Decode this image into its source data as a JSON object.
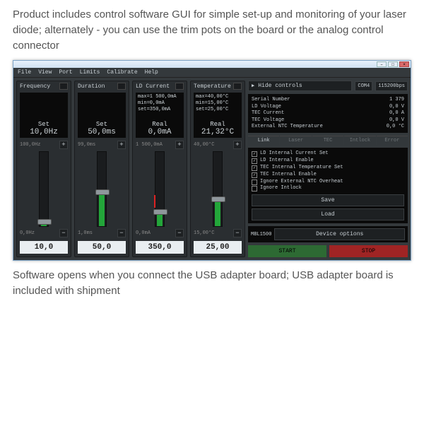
{
  "caption_top": "Product includes control software GUI for simple set-up and monitoring of your laser diode; alternately - you can use the trim pots on the board or the analog control connector",
  "caption_bottom": "Software opens when you connect the USB adapter board; USB adapter board is included with shipment",
  "menu": {
    "file": "File",
    "view": "View",
    "port": "Port",
    "limits": "Limits",
    "calibrate": "Calibrate",
    "help": "Help"
  },
  "channels": [
    {
      "name": "Frequency",
      "label": "Set",
      "value": "10,0Hz",
      "max": "100,0Hz",
      "min": "0,0Hz",
      "input": "10,0",
      "fill": 10,
      "knob": 90
    },
    {
      "name": "Duration",
      "label": "Set",
      "value": "50,0ms",
      "max": "99,0ms",
      "min": "1,0ms",
      "input": "50,0",
      "fill": 50,
      "knob": 50
    },
    {
      "name": "LD Current",
      "label": "Real",
      "value": "0,0mA",
      "m1": "max=1 500,0mA",
      "m2": "min=0,0mA",
      "m3": "set=350,0mA",
      "max": "1 500,0mA",
      "min": "0,0mA",
      "input": "350,0",
      "fill": 23,
      "knob": 77,
      "redline": true
    },
    {
      "name": "Temperature",
      "label": "Real",
      "value": "21,32°C",
      "m1": "max=40,00°C",
      "m2": "min=15,00°C",
      "m3": "set=25,00°C",
      "max": "40,00°C",
      "min": "15,00°C",
      "input": "25,00",
      "fill": 40,
      "knob": 60
    }
  ],
  "side": {
    "hide": "Hide controls",
    "com": "COM4",
    "baud": "115200bps",
    "info": [
      {
        "k": "Serial Number",
        "v": "1 379"
      },
      {
        "k": "LD Voltage",
        "v": "0,0",
        "u": "V"
      },
      {
        "k": "TEC Current",
        "v": "0,0",
        "u": "A"
      },
      {
        "k": "TEC Voltage",
        "v": "0,0",
        "u": "V"
      },
      {
        "k": "External NTC Temperature",
        "v": "0,0",
        "u": "°C"
      }
    ],
    "tabs": [
      "Link",
      "Laser",
      "TEC",
      "Intlock",
      "Error"
    ],
    "checks": [
      {
        "on": true,
        "t": "LD Internal Current Set"
      },
      {
        "on": true,
        "t": "LD Internal Enable"
      },
      {
        "on": true,
        "t": "TEC Internal Temperature Set"
      },
      {
        "on": true,
        "t": "TEC Internal Enable"
      },
      {
        "on": false,
        "t": "Ignore External NTC Overheat"
      },
      {
        "on": false,
        "t": "Ignore Intlock"
      }
    ],
    "save": "Save",
    "load": "Load",
    "device": "MBL1500",
    "devopt": "Device options",
    "start": "START",
    "stop": "STOP"
  }
}
